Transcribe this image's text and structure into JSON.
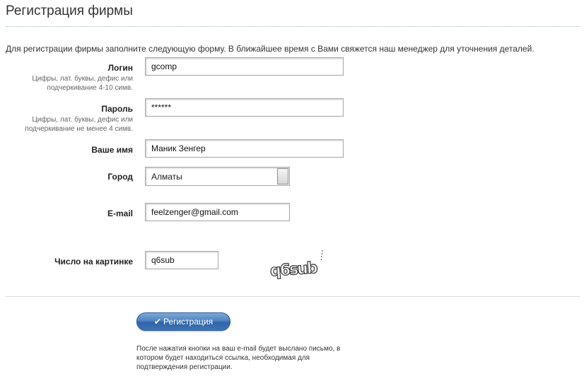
{
  "page": {
    "title": "Регистрация фирмы",
    "intro": "Для регистрации фирмы заполните следующую форму. В ближайшее время с Вами свяжется наш менеджер для уточнения деталей."
  },
  "form": {
    "login": {
      "label": "Логин",
      "hint": "Цифры, лат. буквы, дефис или подчеркивание 4-10 симв.",
      "value": "gcomp"
    },
    "password": {
      "label": "Пароль",
      "hint": "Цифры, лат. буквы, дефис или подчеркивание не менее 4 симв.",
      "value": "******"
    },
    "name": {
      "label": "Ваше имя",
      "value": "Маник Зенгер"
    },
    "city": {
      "label": "Город",
      "value": "Алматы"
    },
    "email": {
      "label": "E-mail",
      "value": "feelzenger@gmail.com"
    },
    "captcha": {
      "label": "Число на картинке",
      "value": "q6sub",
      "image_text": "q6sub"
    }
  },
  "submit": {
    "label": "Регистрация",
    "icon": "check-icon"
  },
  "note": "После нажатия кнопки на ваш e-mail будет выслано письмо, в котором будет находиться ссылка, необходимая для подтверждения регистрации.",
  "colors": {
    "button_top": "#7ea9d8",
    "button_bottom": "#2f64a8",
    "divider": "#9fb7b0"
  }
}
